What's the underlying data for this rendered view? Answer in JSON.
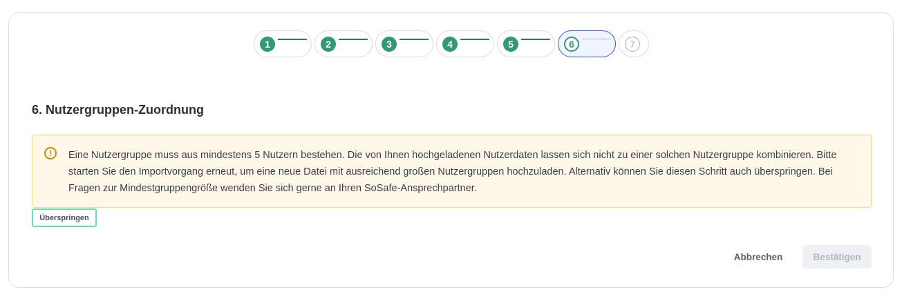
{
  "stepper": {
    "steps": [
      {
        "label": "1",
        "state": "complete"
      },
      {
        "label": "2",
        "state": "complete"
      },
      {
        "label": "3",
        "state": "complete"
      },
      {
        "label": "4",
        "state": "complete"
      },
      {
        "label": "5",
        "state": "complete"
      },
      {
        "label": "6",
        "state": "active"
      },
      {
        "label": "7",
        "state": "upcoming"
      }
    ]
  },
  "section": {
    "title": "6. Nutzergruppen-Zuordnung"
  },
  "alert": {
    "icon": "warning-circle-icon",
    "icon_glyph": "!",
    "message": "Eine Nutzergruppe muss aus mindestens 5 Nutzern bestehen. Die von Ihnen hochgeladenen Nutzerdaten lassen sich nicht zu einer solchen Nutzergruppe kombinieren. Bitte starten Sie den Importvorgang erneut, um eine neue Datei mit ausreichend großen Nutzergruppen hochzuladen. Alternativ können Sie diesen Schritt auch überspringen. Bei Fragen zur Mindestgruppengröße wenden Sie sich gerne an Ihren SoSafe-Ansprechpartner."
  },
  "actions": {
    "skip_label": "Überspringen",
    "cancel_label": "Abbrechen",
    "confirm_label": "Bestätigen"
  },
  "colors": {
    "step_complete": "#2f9a73",
    "step_active_border": "#3b5bd6",
    "alert_bg": "#fff8e8",
    "alert_border": "#f2d68a",
    "skip_focus_border": "#5fe3b0"
  }
}
